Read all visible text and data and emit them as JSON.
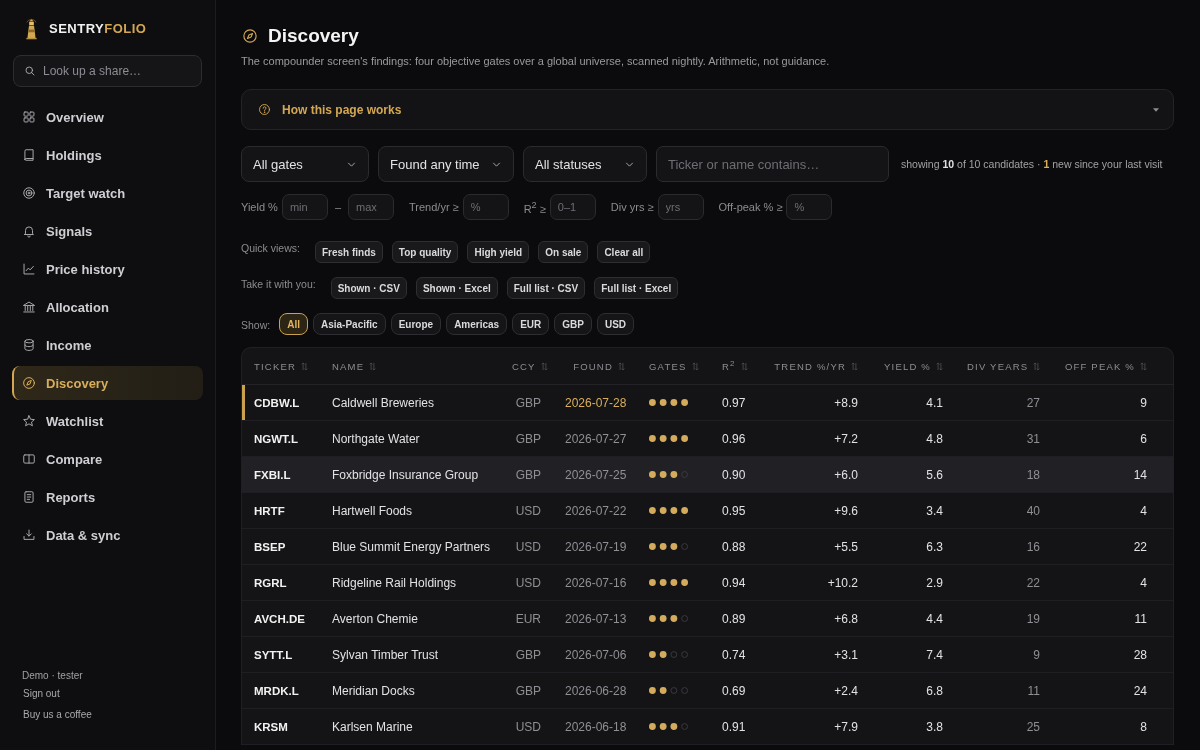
{
  "sidebar": {
    "brand": {
      "part_1": "SENTRY",
      "part_2": "FOLIO"
    },
    "search": {
      "placeholder": "Look up a share…"
    },
    "items": [
      {
        "label": "Overview",
        "selected": false
      },
      {
        "label": "Holdings",
        "selected": false
      },
      {
        "label": "Target watch",
        "selected": false
      },
      {
        "label": "Signals",
        "selected": false
      },
      {
        "label": "Price history",
        "selected": false
      },
      {
        "label": "Allocation",
        "selected": false
      },
      {
        "label": "Income",
        "selected": false
      },
      {
        "label": "Discovery",
        "selected": true
      },
      {
        "label": "Watchlist",
        "selected": false
      },
      {
        "label": "Compare",
        "selected": false
      },
      {
        "label": "Reports",
        "selected": false
      },
      {
        "label": "Data & sync",
        "selected": false
      }
    ],
    "footer": {
      "user": "Demo · tester",
      "links": [
        "Sign out",
        "Buy us a coffee"
      ]
    }
  },
  "header": {
    "title": "Discovery",
    "subtitle": "The compounder screen's findings: four objective gates over a global universe, scanned nightly. Arithmetic, not guidance."
  },
  "help_panel": {
    "label": "How this page works",
    "expanded": false
  },
  "filters": {
    "selects": [
      "All gates",
      "Found any time",
      "All statuses"
    ],
    "search": {
      "placeholder": "Ticker or name contains…"
    },
    "summary": "showing **10** of 10 candidates · **1** new since your last visit"
  },
  "range_filters": [
    {
      "label": "Yield %",
      "placeholders": [
        "min",
        "max"
      ],
      "separator": "–"
    },
    {
      "label": "Trend/yr ≥",
      "placeholders": [
        "%"
      ]
    },
    {
      "label": "R$^{2}$ ≥",
      "placeholders": [
        "0–1"
      ]
    },
    {
      "label": "Div yrs ≥",
      "placeholders": [
        "yrs"
      ]
    },
    {
      "label": "Off-peak % ≥",
      "placeholders": [
        "%"
      ]
    }
  ],
  "quick_views": {
    "label": "Quick views:",
    "buttons": [
      "Fresh finds",
      "Top quality",
      "High yield",
      "On sale",
      "Clear all"
    ]
  },
  "export": {
    "label": "Take it with you:",
    "buttons": [
      "Shown · CSV",
      "Shown · Excel",
      "Full list · CSV",
      "Full list · Excel"
    ]
  },
  "show": {
    "label": "Show:",
    "chips": [
      {
        "label": "All",
        "selected": true
      },
      {
        "label": "Asia-Pacific",
        "selected": false
      },
      {
        "label": "Europe",
        "selected": false
      },
      {
        "label": "Americas",
        "selected": false
      },
      {
        "label": "EUR",
        "selected": false
      },
      {
        "label": "GBP",
        "selected": false
      },
      {
        "label": "USD",
        "selected": false
      }
    ]
  },
  "table": {
    "columns": [
      "TICKER",
      "NAME",
      "CCY",
      "FOUND",
      "GATES",
      "R$^{2}$",
      "TREND %/YR",
      "YIELD %",
      "DIV YEARS",
      "OFF PEAK %"
    ],
    "rows": [
      {
        "ticker": "CDBW.L",
        "name": "Caldwell Breweries",
        "ccy": "GBP",
        "found": "2026-07-28",
        "stars": 4,
        "r2": "0.97",
        "trend": "+8.9",
        "yield": "4.1",
        "div_years": "27",
        "off_peak": "9",
        "new": true,
        "highlighted": false
      },
      {
        "ticker": "NGWT.L",
        "name": "Northgate Water",
        "ccy": "GBP",
        "found": "2026-07-27",
        "stars": 4,
        "r2": "0.96",
        "trend": "+7.2",
        "yield": "4.8",
        "div_years": "31",
        "off_peak": "6",
        "new": false,
        "highlighted": false
      },
      {
        "ticker": "FXBI.L",
        "name": "Foxbridge Insurance Group",
        "ccy": "GBP",
        "found": "2026-07-25",
        "stars": 3,
        "r2": "0.90",
        "trend": "+6.0",
        "yield": "5.6",
        "div_years": "18",
        "off_peak": "14",
        "new": false,
        "highlighted": true
      },
      {
        "ticker": "HRTF",
        "name": "Hartwell Foods",
        "ccy": "USD",
        "found": "2026-07-22",
        "stars": 4,
        "r2": "0.95",
        "trend": "+9.6",
        "yield": "3.4",
        "div_years": "40",
        "off_peak": "4",
        "new": false,
        "highlighted": false
      },
      {
        "ticker": "BSEP",
        "name": "Blue Summit Energy Partners",
        "ccy": "USD",
        "found": "2026-07-19",
        "stars": 3,
        "r2": "0.88",
        "trend": "+5.5",
        "yield": "6.3",
        "div_years": "16",
        "off_peak": "22",
        "new": false,
        "highlighted": false
      },
      {
        "ticker": "RGRL",
        "name": "Ridgeline Rail Holdings",
        "ccy": "USD",
        "found": "2026-07-16",
        "stars": 4,
        "r2": "0.94",
        "trend": "+10.2",
        "yield": "2.9",
        "div_years": "22",
        "off_peak": "4",
        "new": false,
        "highlighted": false
      },
      {
        "ticker": "AVCH.DE",
        "name": "Averton Chemie",
        "ccy": "EUR",
        "found": "2026-07-13",
        "stars": 3,
        "r2": "0.89",
        "trend": "+6.8",
        "yield": "4.4",
        "div_years": "19",
        "off_peak": "11",
        "new": false,
        "highlighted": false
      },
      {
        "ticker": "SYTT.L",
        "name": "Sylvan Timber Trust",
        "ccy": "GBP",
        "found": "2026-07-06",
        "stars": 2,
        "r2": "0.74",
        "trend": "+3.1",
        "yield": "7.4",
        "div_years": "9",
        "off_peak": "28",
        "new": false,
        "highlighted": false
      },
      {
        "ticker": "MRDK.L",
        "name": "Meridian Docks",
        "ccy": "GBP",
        "found": "2026-06-28",
        "stars": 2,
        "r2": "0.69",
        "trend": "+2.4",
        "yield": "6.8",
        "div_years": "11",
        "off_peak": "24",
        "new": false,
        "highlighted": false
      },
      {
        "ticker": "KRSM",
        "name": "Karlsen Marine",
        "ccy": "USD",
        "found": "2026-06-18",
        "stars": 3,
        "r2": "0.91",
        "trend": "+7.9",
        "yield": "3.8",
        "div_years": "25",
        "off_peak": "8",
        "new": false,
        "highlighted": false
      }
    ]
  }
}
